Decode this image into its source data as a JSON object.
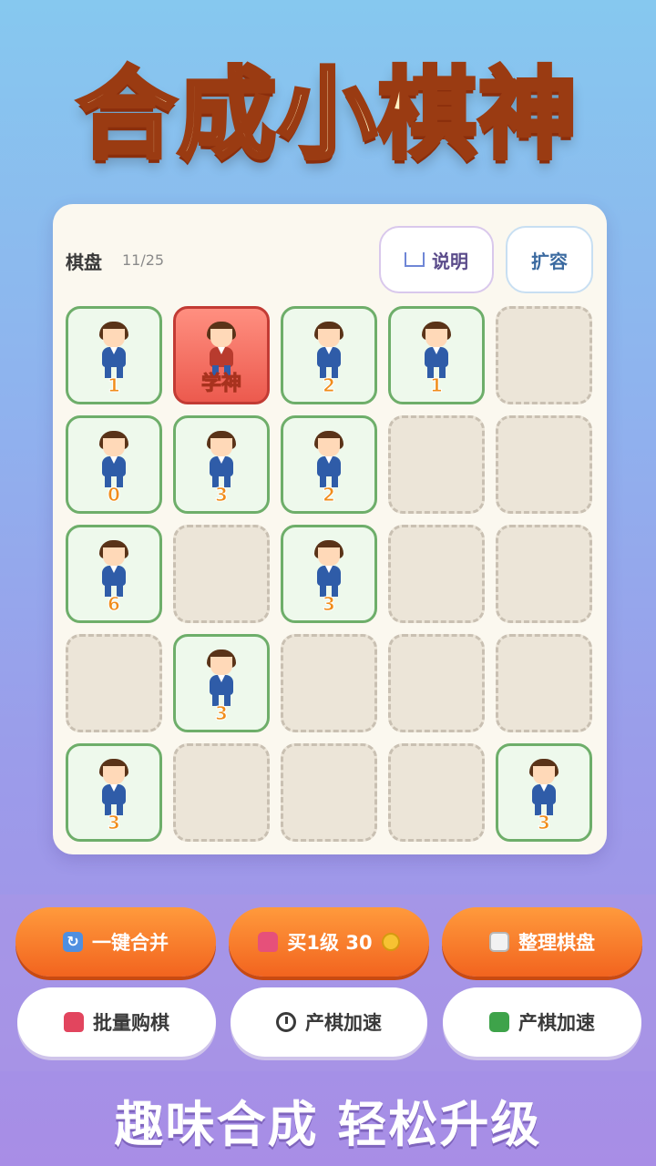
{
  "app_title": "合成小棋神",
  "board": {
    "label": "棋盘",
    "count": "11/25",
    "help_label": "说明",
    "expand_label": "扩容",
    "cells": [
      {
        "type": "piece",
        "level": "1"
      },
      {
        "type": "special",
        "level": "学神"
      },
      {
        "type": "piece",
        "level": "2"
      },
      {
        "type": "piece",
        "level": "1"
      },
      {
        "type": "empty",
        "level": ""
      },
      {
        "type": "piece",
        "level": "0"
      },
      {
        "type": "piece",
        "level": "3"
      },
      {
        "type": "piece",
        "level": "2"
      },
      {
        "type": "empty",
        "level": ""
      },
      {
        "type": "empty",
        "level": ""
      },
      {
        "type": "piece",
        "level": "6"
      },
      {
        "type": "empty",
        "level": ""
      },
      {
        "type": "piece",
        "level": "3"
      },
      {
        "type": "empty",
        "level": ""
      },
      {
        "type": "empty",
        "level": ""
      },
      {
        "type": "empty",
        "level": ""
      },
      {
        "type": "piece",
        "level": "3"
      },
      {
        "type": "empty",
        "level": ""
      },
      {
        "type": "empty",
        "level": ""
      },
      {
        "type": "empty",
        "level": ""
      },
      {
        "type": "piece",
        "level": "3"
      },
      {
        "type": "empty",
        "level": ""
      },
      {
        "type": "empty",
        "level": ""
      },
      {
        "type": "empty",
        "level": ""
      },
      {
        "type": "piece",
        "level": "3"
      }
    ]
  },
  "actions": {
    "merge_all": "一键合并",
    "buy_level1": "买1级 30",
    "tidy_board": "整理棋盘",
    "bulk_buy": "批量购棋",
    "speed_up_1": "产棋加速",
    "speed_up_2": "产棋加速"
  },
  "slogan": "趣味合成 轻松升级",
  "icons": {
    "help": "book-icon",
    "merge_all": "refresh-icon",
    "buy_level1": "bag-icon",
    "coin": "coin-icon",
    "tidy_board": "clipboard-icon",
    "bulk_buy": "bag-icon",
    "speed_up_1": "timer-icon",
    "speed_up_2": "green-book-icon"
  }
}
